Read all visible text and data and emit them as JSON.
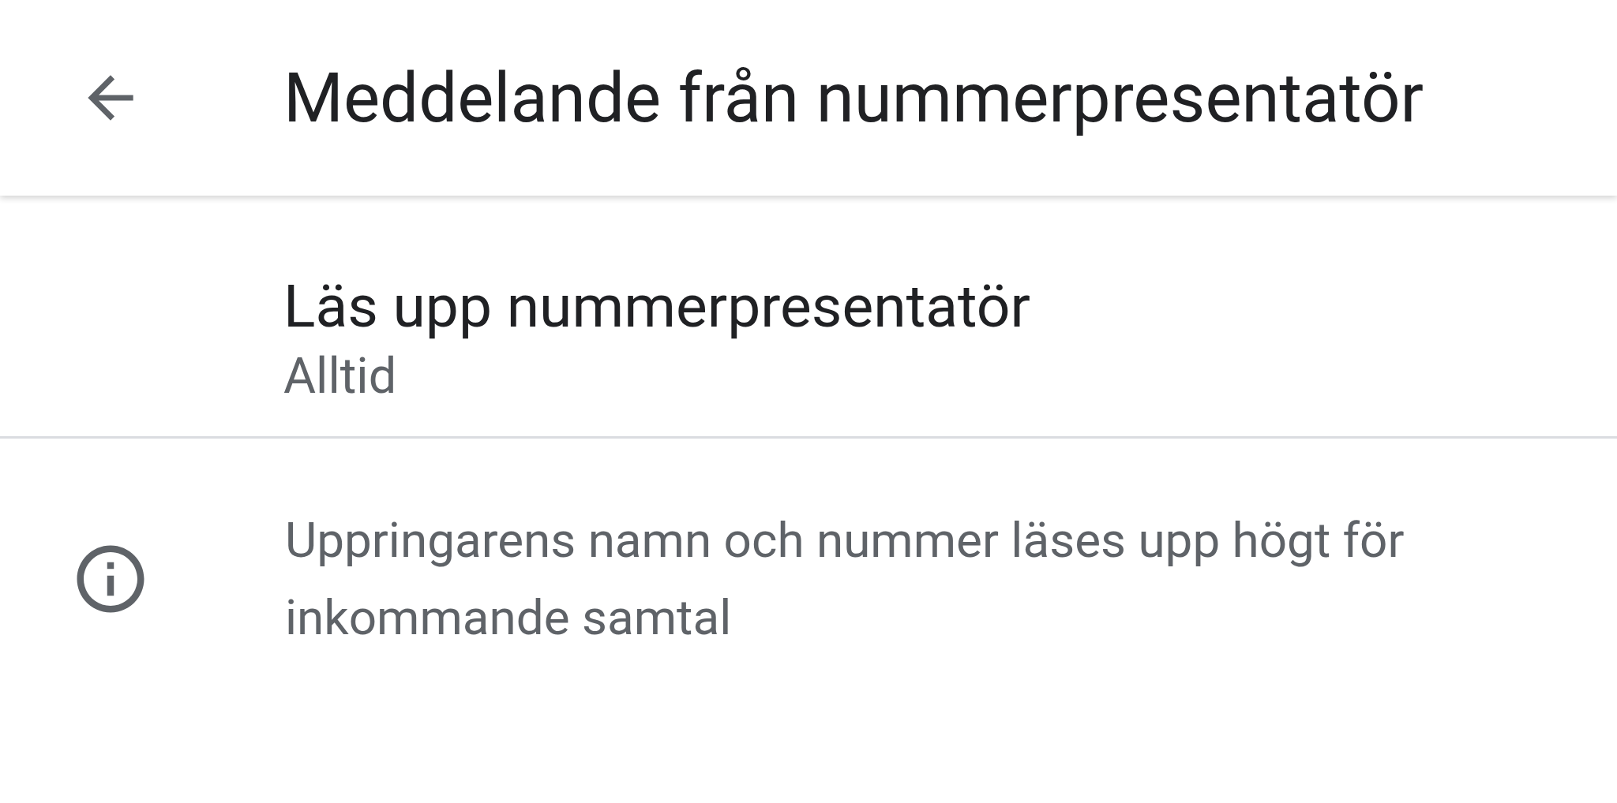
{
  "app_bar": {
    "title": "Meddelande från nummerpresentatör"
  },
  "settings": [
    {
      "kind": "setting",
      "title": "Läs upp nummerpresentatör",
      "summary": "Alltid"
    },
    {
      "kind": "info",
      "text": "Uppringarens namn och nummer läses upp högt för inkommande samtal"
    }
  ]
}
